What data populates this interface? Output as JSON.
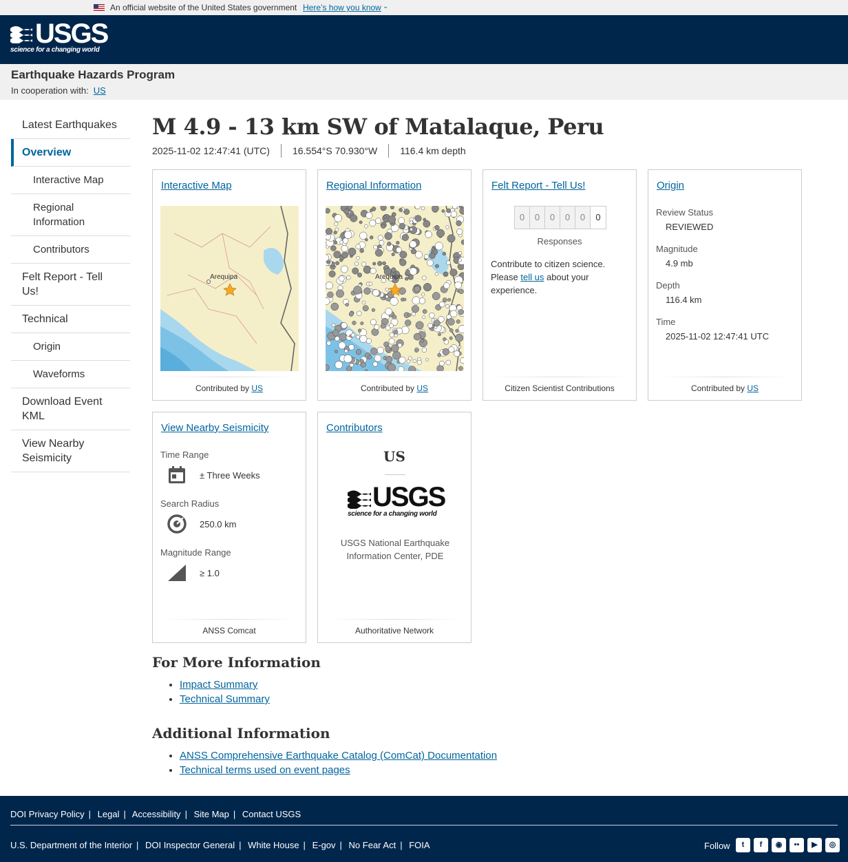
{
  "gov_banner": {
    "text": "An official website of the United States government",
    "link": "Here’s how you know",
    "chevron": "⌄"
  },
  "logo": {
    "word": "USGS",
    "tagline": "science for a changing world"
  },
  "program": {
    "name": "Earthquake Hazards Program",
    "coop_label": "In cooperation with:",
    "coop_link": "US"
  },
  "nav": [
    {
      "label": "Latest Earthquakes"
    },
    {
      "label": "Overview"
    },
    {
      "label": "Interactive Map"
    },
    {
      "label": "Regional Information"
    },
    {
      "label": "Contributors"
    },
    {
      "label": "Felt Report - Tell Us!"
    },
    {
      "label": "Technical"
    },
    {
      "label": "Origin"
    },
    {
      "label": "Waveforms"
    },
    {
      "label": "Download Event KML"
    },
    {
      "label": "View Nearby Seismicity"
    }
  ],
  "event": {
    "title": "M 4.9 - 13 km SW of Matalaque, Peru",
    "time": "2025-11-02 12:47:41 (UTC)",
    "location": "16.554°S 70.930°W",
    "depth": "116.4 km depth"
  },
  "cards": {
    "interactive_map": {
      "title": "Interactive Map",
      "city": "Arequipa",
      "footer_prefix": "Contributed by",
      "footer_link": "US"
    },
    "regional": {
      "title": "Regional Information",
      "city": "Arequipa",
      "footer_prefix": "Contributed by",
      "footer_link": "US"
    },
    "felt": {
      "title": "Felt Report - Tell Us!",
      "digits": [
        "0",
        "0",
        "0",
        "0",
        "0",
        "0"
      ],
      "responses_label": "Responses",
      "text1": "Contribute to citizen science. Please",
      "link": "tell us",
      "text2": "about your experience.",
      "footer": "Citizen Scientist Contributions"
    },
    "origin": {
      "title": "Origin",
      "review_label": "Review Status",
      "review_value": "REVIEWED",
      "mag_label": "Magnitude",
      "mag_value": "4.9 mb",
      "depth_label": "Depth",
      "depth_value": "116.4 km",
      "time_label": "Time",
      "time_value": "2025-11-02 12:47:41 UTC",
      "footer_prefix": "Contributed by",
      "footer_link": "US"
    },
    "nearby": {
      "title": "View Nearby Seismicity",
      "time_label": "Time Range",
      "time_value": "± Three Weeks",
      "radius_label": "Search Radius",
      "radius_value": "250.0 km",
      "mag_label": "Magnitude Range",
      "mag_value": "≥ 1.0",
      "footer": "ANSS Comcat"
    },
    "contributors": {
      "title": "Contributors",
      "network": "US",
      "org": "USGS National Earthquake Information Center, PDE",
      "footer": "Authoritative Network"
    }
  },
  "more_info": {
    "heading": "For More Information",
    "links": [
      "Impact Summary",
      "Technical Summary"
    ]
  },
  "additional": {
    "heading": "Additional Information",
    "links": [
      "ANSS Comprehensive Earthquake Catalog (ComCat) Documentation",
      "Technical terms used on event pages"
    ]
  },
  "footer": {
    "row1": [
      "DOI Privacy Policy",
      "Legal",
      "Accessibility",
      "Site Map",
      "Contact USGS"
    ],
    "row2": [
      "U.S. Department of the Interior",
      "DOI Inspector General",
      "White House",
      "E-gov",
      "No Fear Act",
      "FOIA"
    ],
    "follow": "Follow",
    "social_icons": [
      "twitter-icon",
      "facebook-icon",
      "github-icon",
      "flickr-icon",
      "youtube-icon",
      "instagram-icon"
    ]
  },
  "colors": {
    "header_bg": "#00264c",
    "link": "#00649e",
    "map_land": "#f5efc9",
    "map_water": "#8fcbe8",
    "star": "#f7a823"
  }
}
